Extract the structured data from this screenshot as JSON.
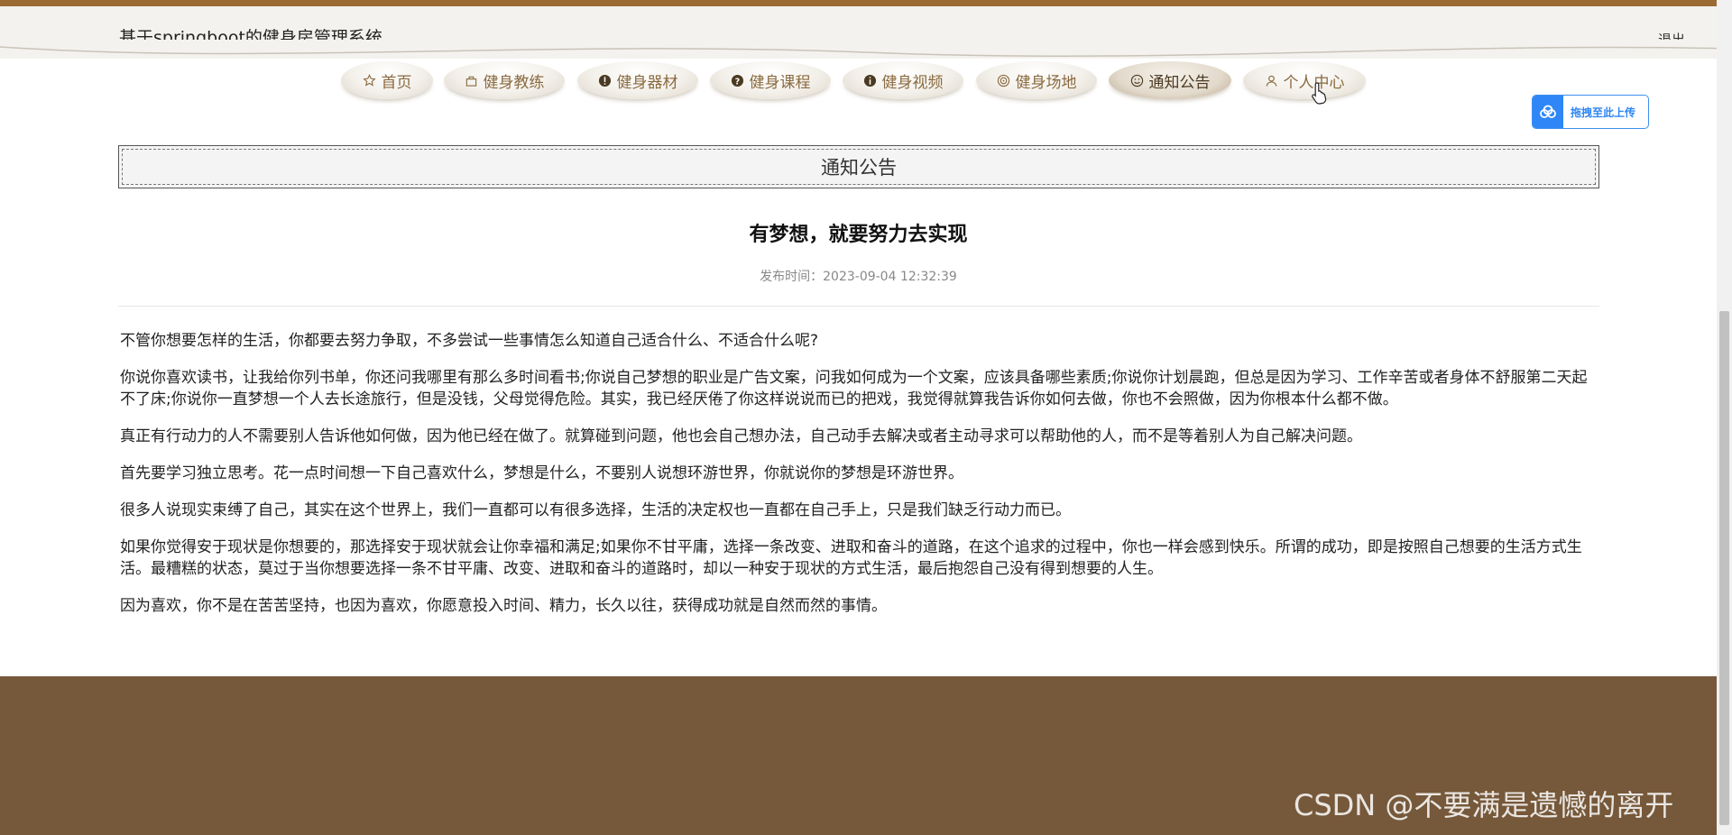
{
  "header": {
    "site_title": "基于springboot的健身房管理系统",
    "logout_label": "退出"
  },
  "nav": {
    "items": [
      {
        "label": "首页",
        "icon": "star-icon"
      },
      {
        "label": "健身教练",
        "icon": "bag-icon"
      },
      {
        "label": "健身器材",
        "icon": "info-circle-icon"
      },
      {
        "label": "健身课程",
        "icon": "question-circle-icon"
      },
      {
        "label": "健身视频",
        "icon": "info-circle-icon"
      },
      {
        "label": "健身场地",
        "icon": "target-icon"
      },
      {
        "label": "通知公告",
        "icon": "smile-icon"
      },
      {
        "label": "个人中心",
        "icon": "user-icon"
      }
    ],
    "active": "通知公告"
  },
  "upload_badge": {
    "label": "拖拽至此上传"
  },
  "section": {
    "title": "通知公告"
  },
  "article": {
    "title": "有梦想，就要努力去实现",
    "publish_time": "发布时间：2023-09-04 12:32:39",
    "paragraphs": [
      "不管你想要怎样的生活，你都要去努力争取，不多尝试一些事情怎么知道自己适合什么、不适合什么呢?",
      "你说你喜欢读书，让我给你列书单，你还问我哪里有那么多时间看书;你说自己梦想的职业是广告文案，问我如何成为一个文案，应该具备哪些素质;你说你计划晨跑，但总是因为学习、工作辛苦或者身体不舒服第二天起不了床;你说你一直梦想一个人去长途旅行，但是没钱，父母觉得危险。其实，我已经厌倦了你这样说说而已的把戏，我觉得就算我告诉你如何去做，你也不会照做，因为你根本什么都不做。",
      "真正有行动力的人不需要别人告诉他如何做，因为他已经在做了。就算碰到问题，他也会自己想办法，自己动手去解决或者主动寻求可以帮助他的人，而不是等着别人为自己解决问题。",
      "首先要学习独立思考。花一点时间想一下自己喜欢什么，梦想是什么，不要别人说想环游世界，你就说你的梦想是环游世界。",
      "很多人说现实束缚了自己，其实在这个世界上，我们一直都可以有很多选择，生活的决定权也一直都在自己手上，只是我们缺乏行动力而已。",
      "如果你觉得安于现状是你想要的，那选择安于现状就会让你幸福和满足;如果你不甘平庸，选择一条改变、进取和奋斗的道路，在这个追求的过程中，你也一样会感到快乐。所谓的成功，即是按照自己想要的生活方式生活。最糟糕的状态，莫过于当你想要选择一条不甘平庸、改变、进取和奋斗的道路时，却以一种安于现状的方式生活，最后抱怨自己没有得到想要的人生。",
      "因为喜欢，你不是在苦苦坚持，也因为喜欢，你愿意投入时间、精力，长久以往，获得成功就是自然而然的事情。"
    ]
  },
  "watermark": "CSDN @不要满是遗憾的离开",
  "colors": {
    "accent_brown": "#9a6b32",
    "footer_brown": "#76583a",
    "nav_text": "#8a6a3f",
    "upload_blue": "#2f86f6"
  }
}
